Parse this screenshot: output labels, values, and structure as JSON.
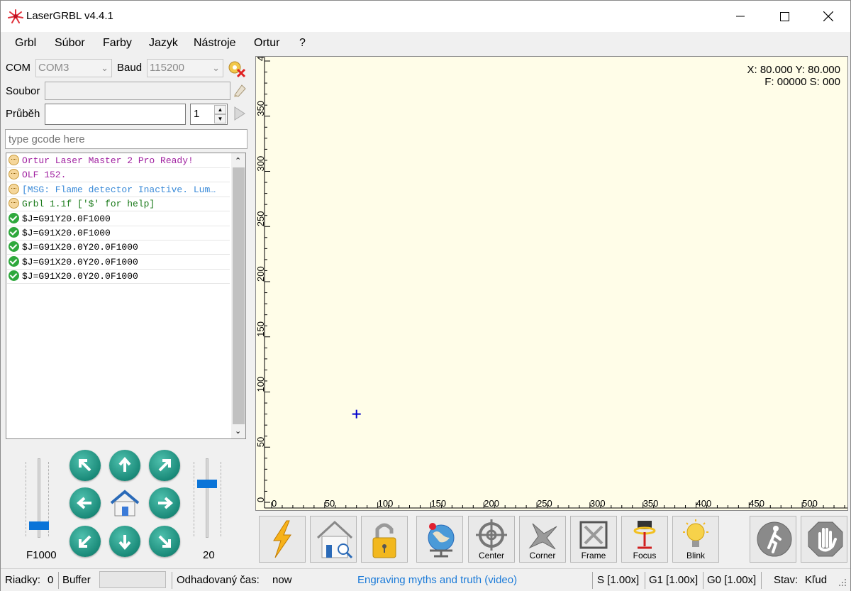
{
  "window": {
    "title": "LaserGRBL v4.4.1"
  },
  "menu": [
    "Grbl",
    "Súbor",
    "Farby",
    "Jazyk",
    "Nástroje",
    "Ortur",
    "?"
  ],
  "connection": {
    "com_label": "COM",
    "com_value": "COM3",
    "baud_label": "Baud",
    "baud_value": "115200",
    "file_label": "Soubor",
    "file_value": "",
    "progress_label": "Průběh",
    "passes_value": "1"
  },
  "gcode_input": {
    "placeholder": "type gcode here"
  },
  "console": [
    {
      "icon": "info-icon",
      "text": "Ortur Laser Master 2 Pro Ready!",
      "color": "#a020a0"
    },
    {
      "icon": "info-icon",
      "text": "OLF 152.",
      "color": "#a020a0"
    },
    {
      "icon": "info-icon",
      "text": "[MSG: Flame detector Inactive. Lum…",
      "color": "#3a8ad8"
    },
    {
      "icon": "info-icon",
      "text": "Grbl 1.1f ['$' for help]",
      "color": "#1a7a1a"
    },
    {
      "icon": "ok-icon",
      "text": "$J=G91Y20.0F1000",
      "color": "#000000"
    },
    {
      "icon": "ok-icon",
      "text": "$J=G91X20.0F1000",
      "color": "#000000"
    },
    {
      "icon": "ok-icon",
      "text": "$J=G91X20.0Y20.0F1000",
      "color": "#000000"
    },
    {
      "icon": "ok-icon",
      "text": "$J=G91X20.0Y20.0F1000",
      "color": "#000000"
    },
    {
      "icon": "ok-icon",
      "text": "$J=G91X20.0Y20.0F1000",
      "color": "#000000"
    }
  ],
  "jog": {
    "speed_label": "F1000",
    "step_label": "20",
    "speed_slider_fraction": 0.15,
    "step_slider_fraction": 0.68
  },
  "canvas": {
    "coords_line1": "X: 80.000 Y: 80.000",
    "coords_line2": "F: 00000 S: 000",
    "x_ticks": [
      "0",
      "50",
      "100",
      "150",
      "200",
      "250",
      "300",
      "350",
      "400",
      "450",
      "500"
    ],
    "y_ticks": [
      "0",
      "50",
      "100",
      "150",
      "200",
      "250",
      "300",
      "350",
      "400"
    ],
    "x_max": 540,
    "y_max": 400,
    "cursor_x": 80,
    "cursor_y": 80,
    "background": "#fffde8",
    "cursor_color": "#0000cc"
  },
  "toolbar": [
    {
      "name": "run-icon",
      "caption": ""
    },
    {
      "name": "home-icon",
      "caption": ""
    },
    {
      "name": "unlock-icon",
      "caption": ""
    },
    {
      "name": "globe-icon",
      "caption": ""
    },
    {
      "name": "center-icon",
      "caption": "Center"
    },
    {
      "name": "corner-icon",
      "caption": "Corner"
    },
    {
      "name": "frame-icon",
      "caption": "Frame"
    },
    {
      "name": "focus-icon",
      "caption": "Focus"
    },
    {
      "name": "blink-icon",
      "caption": "Blink"
    },
    {
      "name": "walk-icon",
      "caption": ""
    },
    {
      "name": "stop-icon",
      "caption": ""
    }
  ],
  "status": {
    "lines_label": "Riadky:",
    "lines_value": "0",
    "buffer_label": "Buffer",
    "time_label": "Odhadovaný čas:",
    "time_value": "now",
    "link_text": "Engraving myths and truth (video)",
    "s_value": "S [1.00x]",
    "g1_value": "G1 [1.00x]",
    "g0_value": "G0 [1.00x]",
    "state_label": "Stav:",
    "state_value": "Kľud"
  },
  "colors": {
    "link": "#1a7ad8",
    "jog": "#1a8a79",
    "slider": "#0a74d8"
  }
}
